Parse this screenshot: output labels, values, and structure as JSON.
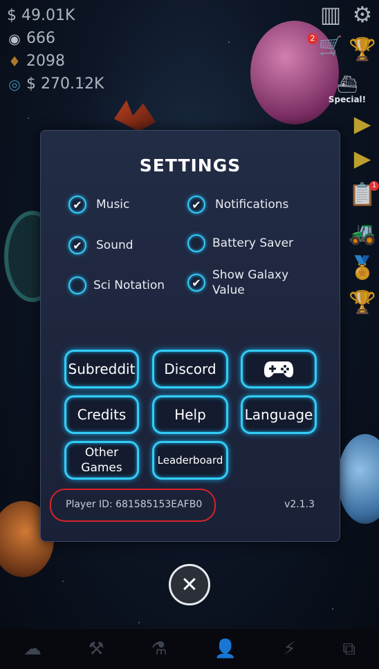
{
  "hud": {
    "money": "$ 49.01K",
    "gems": "666",
    "ether": "2098",
    "rate": "$ 270.12K"
  },
  "sidebar": {
    "special_label": "Special!",
    "cart_badge": "2",
    "quest_badge": "1"
  },
  "settings": {
    "title": "SETTINGS",
    "options": {
      "music": {
        "label": "Music",
        "checked": true
      },
      "notifications": {
        "label": "Notifications",
        "checked": true
      },
      "sound": {
        "label": "Sound",
        "checked": true
      },
      "battery_saver": {
        "label": "Battery Saver",
        "checked": false
      },
      "sci_notation": {
        "label": "Sci Notation",
        "checked": false
      },
      "show_galaxy_value": {
        "label": "Show Galaxy Value",
        "line1": "Show Galaxy",
        "line2": "Value",
        "checked": true
      }
    },
    "buttons": {
      "subreddit": "Subreddit",
      "discord": "Discord",
      "credits": "Credits",
      "help": "Help",
      "language": "Language",
      "other_games": "Other Games",
      "other_line1": "Other",
      "other_line2": "Games",
      "leaderboard": "Leaderboard"
    },
    "player_id": "Player ID: 681585153EAFB0",
    "version": "v2.1.3"
  },
  "icons": {
    "money": "dollar-icon",
    "gems": "gem-icon",
    "ether": "ether-icon",
    "rate": "target-icon",
    "controller": "gamepad-icon",
    "close": "close-icon"
  },
  "colors": {
    "accent": "#33cdf5",
    "highlight": "#d9232a",
    "panel": "#1f2840"
  }
}
